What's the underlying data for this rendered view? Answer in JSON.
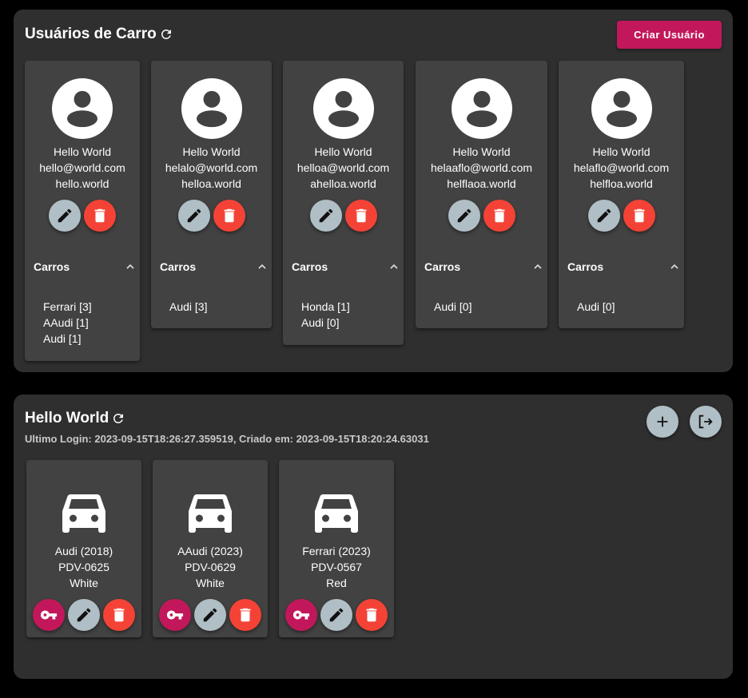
{
  "users_panel": {
    "title": "Usuários de Carro",
    "create_label": "Criar Usuário",
    "users": [
      {
        "name": "Hello World",
        "email": "hello@world.com",
        "login": "hello.world",
        "cars_label": "Carros",
        "cars": [
          "Ferrari [3]",
          "AAudi [1]",
          "Audi [1]"
        ]
      },
      {
        "name": "Hello World",
        "email": "helalo@world.com",
        "login": "helloa.world",
        "cars_label": "Carros",
        "cars": [
          "Audi [3]"
        ]
      },
      {
        "name": "Hello World",
        "email": "helloa@world.com",
        "login": "ahelloa.world",
        "cars_label": "Carros",
        "cars": [
          "Honda [1]",
          "Audi [0]"
        ]
      },
      {
        "name": "Hello World",
        "email": "helaaflo@world.com",
        "login": "helflaoa.world",
        "cars_label": "Carros",
        "cars": [
          "Audi [0]"
        ]
      },
      {
        "name": "Hello World",
        "email": "helaflo@world.com",
        "login": "helfloa.world",
        "cars_label": "Carros",
        "cars": [
          "Audi [0]"
        ]
      }
    ]
  },
  "user_panel": {
    "title": "Hello World",
    "subtitle": "Ultimo Login: 2023-09-15T18:26:27.359519, Criado em: 2023-09-15T18:20:24.63031",
    "cars": [
      {
        "model": "Audi (2018)",
        "plate": "PDV-0625",
        "color": "White"
      },
      {
        "model": "AAudi (2023)",
        "plate": "PDV-0629",
        "color": "White"
      },
      {
        "model": "Ferrari (2023)",
        "plate": "PDV-0567",
        "color": "Red"
      }
    ]
  },
  "colors": {
    "accent": "#c2185b",
    "edit": "#b0bec5",
    "delete": "#f44336",
    "panel": "#302f30",
    "card": "#424242"
  }
}
